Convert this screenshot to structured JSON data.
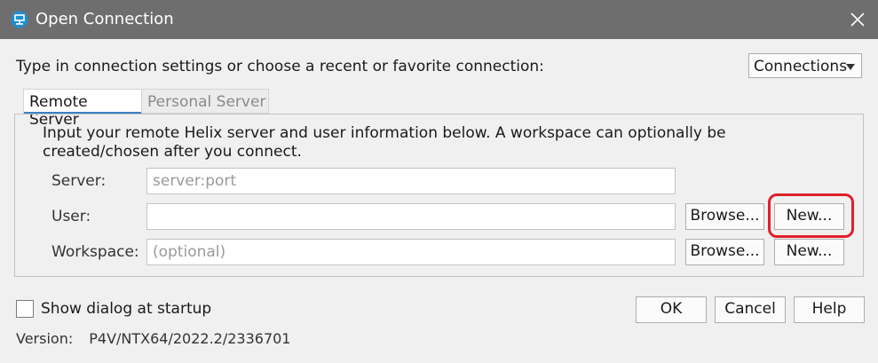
{
  "window": {
    "title": "Open Connection"
  },
  "intro_text": "Type in connection settings or choose a recent or favorite connection:",
  "connections_dropdown": {
    "label": "Connections"
  },
  "tabs": [
    {
      "label": "Remote Server",
      "active": true
    },
    {
      "label": "Personal Server",
      "active": false
    }
  ],
  "remote": {
    "description": "Input your remote Helix server and user information below. A workspace can optionally be created/chosen after you connect.",
    "server": {
      "label": "Server:",
      "placeholder": "server:port",
      "value": ""
    },
    "user": {
      "label": "User:",
      "value": ""
    },
    "workspace": {
      "label": "Workspace:",
      "placeholder": "(optional)",
      "value": ""
    },
    "browse_label": "Browse...",
    "new_label": "New..."
  },
  "show_dialog_label": "Show dialog at startup",
  "show_dialog_checked": false,
  "buttons": {
    "ok": "OK",
    "cancel": "Cancel",
    "help": "Help"
  },
  "version": {
    "label": "Version:",
    "value": "P4V/NTX64/2022.2/2336701"
  },
  "colors": {
    "titlebar": "#6e6e6e",
    "accent": "#3a83c5",
    "highlight": "#e0202a"
  },
  "icons": {
    "app": "p4v-connection-icon",
    "close": "close-icon",
    "dropdown": "chevron-down-icon"
  }
}
